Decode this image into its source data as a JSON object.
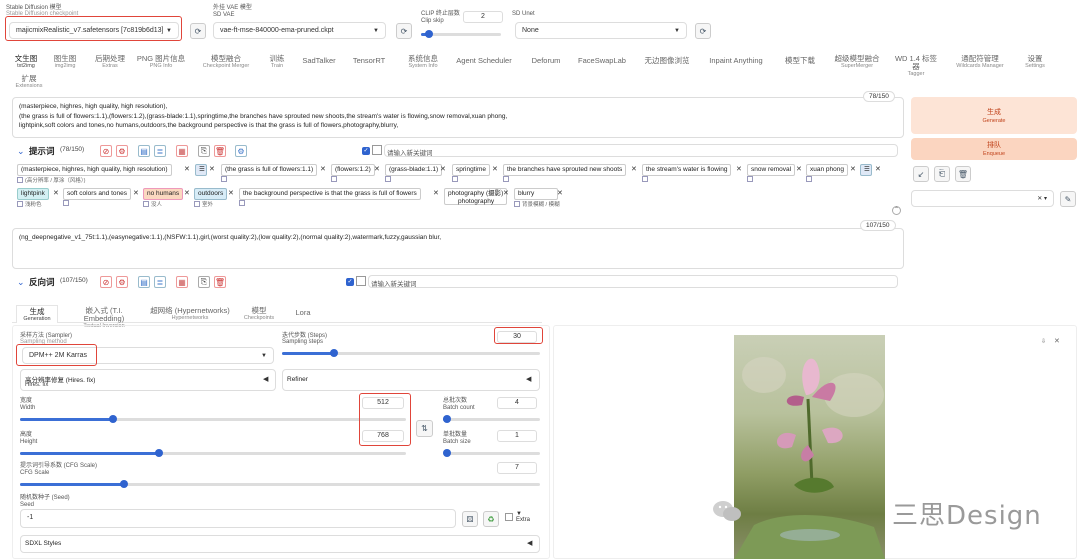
{
  "model": {
    "checkpoint_label": "Stable Diffusion 模型",
    "checkpoint_sublabel": "Stable Diffusion checkpoint",
    "checkpoint_value": "majicmixRealistic_v7.safetensors [7c819b6d13]",
    "vae_label": "外挂 VAE 模型",
    "vae_sublabel": "SD VAE",
    "vae_value": "vae-ft-mse-840000-ema-pruned.ckpt",
    "clip_label": "CLIP 终止层数",
    "clip_sublabel": "Clip skip",
    "clip_value": "2",
    "clip_fraction": 0.1,
    "unet_label": "SD Unet",
    "unet_value": "None"
  },
  "tabs": [
    {
      "cn": "文生图",
      "en": "txt2img"
    },
    {
      "cn": "图生图",
      "en": "img2img"
    },
    {
      "cn": "后期处理",
      "en": "Extras"
    },
    {
      "cn": "PNG 图片信息",
      "en": "PNG Info"
    },
    {
      "cn": "模型融合",
      "en": "Checkpoint Merger"
    },
    {
      "cn": "训练",
      "en": "Train"
    },
    {
      "cn": "SadTalker",
      "en": ""
    },
    {
      "cn": "TensorRT",
      "en": ""
    },
    {
      "cn": "系统信息",
      "en": "System Info"
    },
    {
      "cn": "Agent Scheduler",
      "en": ""
    },
    {
      "cn": "Deforum",
      "en": ""
    },
    {
      "cn": "FaceSwapLab",
      "en": ""
    },
    {
      "cn": "无边图像浏览",
      "en": ""
    },
    {
      "cn": "Inpaint Anything",
      "en": ""
    },
    {
      "cn": "模型下载",
      "en": ""
    },
    {
      "cn": "超级模型融合",
      "en": "SuperMerger"
    },
    {
      "cn": "WD 1.4 标签器",
      "en": "Tagger"
    },
    {
      "cn": "通配符管理",
      "en": "Wildcards Manager"
    },
    {
      "cn": "设置",
      "en": "Settings"
    },
    {
      "cn": "扩展",
      "en": "Extensions"
    }
  ],
  "prompt": {
    "line1": "(masterpiece, highres, high quality, high resolution),",
    "line2": "(the grass is full of flowers:1.1),(flowers:1.2),(grass-blade:1.1),springtime,the branches have sprouted new shoots,the stream's water is flowing,snow removal,xuan phong,",
    "line3": "lightpink,soft colors and tones,no humans,outdoors,the background perspective is that the grass is full of flowers,photography,blurry,",
    "counter": "78/150",
    "title": "提示词",
    "count_label": "(78/150)",
    "keyword_placeholder": "请输入新关键词"
  },
  "tags_row1": [
    {
      "text": "(masterpiece, highres, high quality, high resolution)",
      "sub": "(高分辨率 / 厚涂（风格）)"
    },
    {
      "text": "(the grass is full of flowers:1.1)",
      "sub": ""
    },
    {
      "text": "(flowers:1.2)",
      "sub": ""
    },
    {
      "text": "(grass-blade:1.1)",
      "sub": ""
    },
    {
      "text": "springtime",
      "sub": ""
    },
    {
      "text": "the branches have sprouted new shoots",
      "sub": ""
    },
    {
      "text": "the stream's water is flowing",
      "sub": ""
    },
    {
      "text": "snow removal",
      "sub": ""
    },
    {
      "text": "xuan phong",
      "sub": ""
    }
  ],
  "tags_row2": [
    {
      "text": "lightpink",
      "sub": "浅粉色"
    },
    {
      "text": "soft colors and tones",
      "sub": ""
    },
    {
      "text": "no humans",
      "sub": "没人"
    },
    {
      "text": "outdoors",
      "sub": "室外"
    },
    {
      "text": "the background perspective is that the grass is full of flowers",
      "sub": ""
    },
    {
      "text": "photography (摄影)",
      "text2": "photography",
      "sub": ""
    },
    {
      "text": "blurry",
      "sub": "背景模糊 / 模糊"
    }
  ],
  "negative": {
    "text": "(ng_deepnegative_v1_75t:1.1),(easynegative:1.1),(NSFW:1.1),girl,(worst quality:2),(low quality:2),(normal quality:2),watermark,fuzzy,gaussian blur,",
    "counter": "107/150",
    "title": "反向词",
    "count_label": "(107/150)",
    "keyword_placeholder": "请输入新关键词"
  },
  "actions": {
    "generate_cn": "生成",
    "generate_en": "Generate",
    "enqueue_cn": "排队",
    "enqueue_en": "Enqueue"
  },
  "subtabs": [
    {
      "cn": "生成",
      "en": "Generation"
    },
    {
      "cn": "嵌入式 (T.I. Embedding)",
      "en": "Textual Inversion"
    },
    {
      "cn": "超网络 (Hypernetworks)",
      "en": "Hypernetworks"
    },
    {
      "cn": "模型",
      "en": "Checkpoints"
    },
    {
      "cn": "Lora",
      "en": ""
    }
  ],
  "params": {
    "sampler_label": "采样方法 (Sampler)",
    "sampler_sublabel": "Sampling method",
    "sampler_value": "DPM++ 2M Karras",
    "steps_label": "迭代步数 (Steps)",
    "steps_sublabel": "Sampling steps",
    "steps_value": "30",
    "steps_fraction": 0.2,
    "hires_label": "高分辨率修复 (Hires. fix)",
    "hires_sublabel": "Hires. fix",
    "refiner_label": "Refiner",
    "width_label": "宽度",
    "width_sublabel": "Width",
    "width_value": "512",
    "width_fraction": 0.24,
    "height_label": "高度",
    "height_sublabel": "Height",
    "height_value": "768",
    "height_fraction": 0.36,
    "batch_count_label": "总批次数",
    "batch_count_sublabel": "Batch count",
    "batch_count_value": "4",
    "batch_count_fraction": 0.03,
    "batch_size_label": "单批数量",
    "batch_size_sublabel": "Batch size",
    "batch_size_value": "1",
    "batch_size_fraction": 0.0,
    "cfg_label": "提示词引导系数 (CFG Scale)",
    "cfg_sublabel": "CFG Scale",
    "cfg_value": "7",
    "cfg_fraction": 0.2,
    "seed_label": "随机数种子 (Seed)",
    "seed_sublabel": "Seed",
    "seed_value": "-1",
    "extra_label": "Extra",
    "sdxl_label": "SDXL Styles"
  },
  "watermark": "三思Design"
}
